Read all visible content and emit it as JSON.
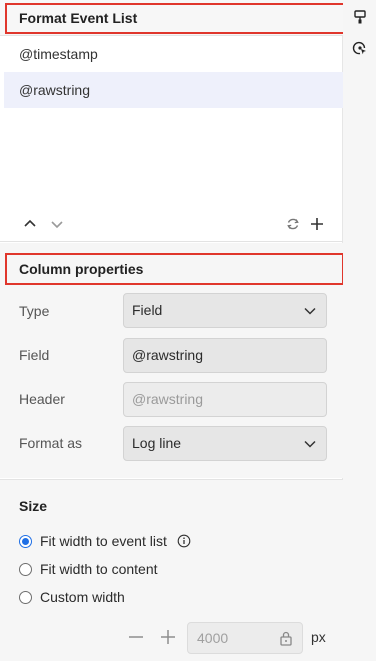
{
  "panel": {
    "title": "Format Event List"
  },
  "events": [
    {
      "label": "@timestamp",
      "selected": false
    },
    {
      "label": "@rawstring",
      "selected": true
    }
  ],
  "list_toolbar": {
    "up_icon": "chevron-up-icon",
    "down_icon": "chevron-down-icon",
    "reset_icon": "reset-icon",
    "add_icon": "plus-icon"
  },
  "column_properties": {
    "title": "Column properties",
    "type": {
      "label": "Type",
      "value": "Field"
    },
    "field": {
      "label": "Field",
      "value": "@rawstring"
    },
    "header": {
      "label": "Header",
      "placeholder": "@rawstring"
    },
    "format_as": {
      "label": "Format as",
      "value": "Log line"
    }
  },
  "size": {
    "title": "Size",
    "options": [
      {
        "label": "Fit width to event list",
        "checked": true,
        "info": true
      },
      {
        "label": "Fit width to content",
        "checked": false
      },
      {
        "label": "Custom width",
        "checked": false
      }
    ],
    "width_value": "4000",
    "unit": "px"
  },
  "colors": {
    "highlight": "#e0362c",
    "accent": "#1f6fe5",
    "selected_row": "#eef0fb"
  }
}
